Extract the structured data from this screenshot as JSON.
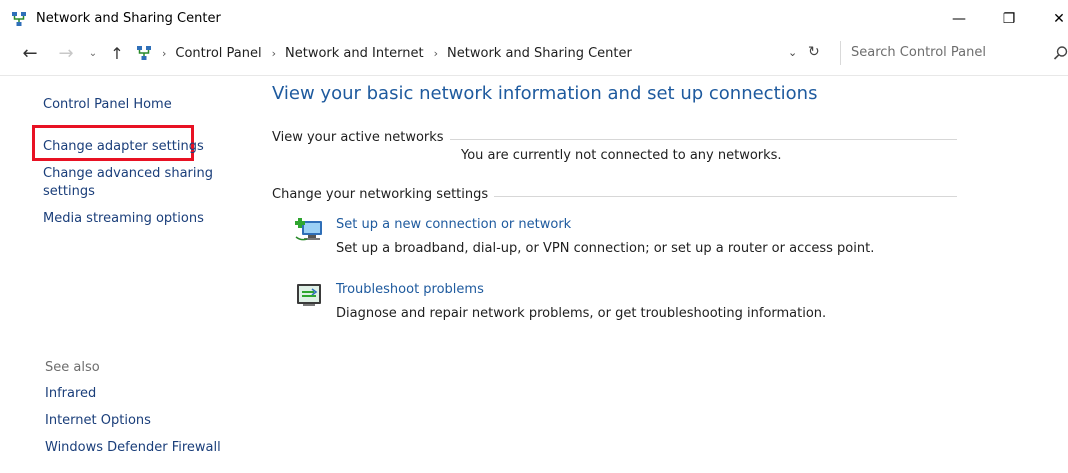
{
  "window": {
    "title": "Network and Sharing Center",
    "minimize_glyph": "—",
    "maximize_glyph": "❐",
    "close_glyph": "✕"
  },
  "address": {
    "crumbs": [
      "Control Panel",
      "Network and Internet",
      "Network and Sharing Center"
    ],
    "search_placeholder": "Search Control Panel"
  },
  "sidebar": {
    "home": "Control Panel Home",
    "adapter": "Change adapter settings",
    "advanced": "Change advanced sharing settings",
    "media": "Media streaming options",
    "see_also": "See also",
    "see_also_links": [
      "Infrared",
      "Internet Options",
      "Windows Defender Firewall"
    ]
  },
  "main": {
    "title": "View your basic network information and set up connections",
    "active_heading": "View your active networks",
    "not_connected": "You are currently not connected to any networks.",
    "settings_heading": "Change your networking settings",
    "tasks": [
      {
        "link": "Set up a new connection or network",
        "desc": "Set up a broadband, dial-up, or VPN connection; or set up a router or access point."
      },
      {
        "link": "Troubleshoot problems",
        "desc": "Diagnose and repair network problems, or get troubleshooting information."
      }
    ]
  },
  "colors": {
    "link": "#1e5a9e",
    "highlight": "#e81123"
  },
  "icons": {
    "title": "network-icon",
    "setup": "network-setup-icon",
    "troubleshoot": "troubleshoot-icon",
    "search": "search-icon"
  }
}
